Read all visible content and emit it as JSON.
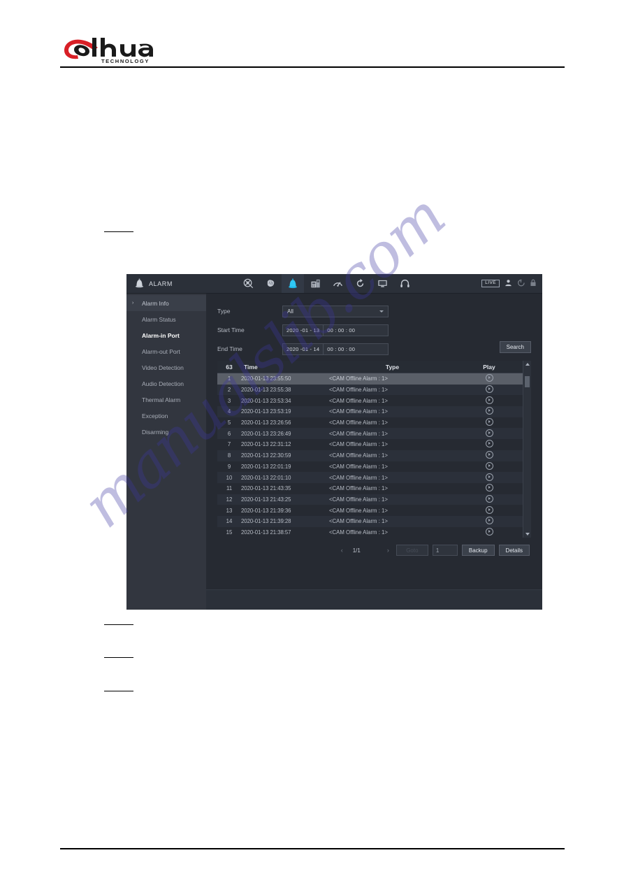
{
  "document": {
    "brand": "alhua",
    "brand_sub": "TECHNOLOGY",
    "watermark": "manualslib.com"
  },
  "nvr": {
    "title": "ALARM",
    "title_icon": "alarm-light-icon",
    "nav_icons": [
      {
        "name": "ai-search-icon",
        "active": false
      },
      {
        "name": "brain-ai-icon",
        "active": false
      },
      {
        "name": "alarm-bell-icon",
        "active": true
      },
      {
        "name": "pos-device-icon",
        "active": false
      },
      {
        "name": "network-speed-icon",
        "active": false
      },
      {
        "name": "maintenance-refresh-icon",
        "active": false
      },
      {
        "name": "display-monitor-icon",
        "active": false
      },
      {
        "name": "audio-headset-icon",
        "active": false
      }
    ],
    "status": {
      "live_badge": "LIVE",
      "icons": [
        "user-account-icon",
        "logout-icon",
        "lock-icon"
      ]
    },
    "sidebar": {
      "items": [
        {
          "label": "Alarm Info",
          "state": "expanded"
        },
        {
          "label": "Alarm Status",
          "state": "normal"
        },
        {
          "label": "Alarm-in Port",
          "state": "selected"
        },
        {
          "label": "Alarm-out Port",
          "state": "normal"
        },
        {
          "label": "Video Detection",
          "state": "normal"
        },
        {
          "label": "Audio Detection",
          "state": "normal"
        },
        {
          "label": "Thermal Alarm",
          "state": "normal"
        },
        {
          "label": "Exception",
          "state": "normal"
        },
        {
          "label": "Disarming",
          "state": "normal"
        }
      ]
    },
    "form": {
      "type_label": "Type",
      "type_value": "All",
      "start_label": "Start Time",
      "start_date": "2020 -01 - 13",
      "start_time": "00 : 00 : 00",
      "end_label": "End Time",
      "end_date": "2020 -01 - 14",
      "end_time": "00 : 00 : 00",
      "search_label": "Search"
    },
    "table": {
      "headers": {
        "count": "63",
        "time": "Time",
        "type": "Type",
        "play": "Play"
      },
      "rows": [
        {
          "no": "1",
          "time": "2020-01-13 23:55:50",
          "type": "<CAM Offline Alarm : 1>",
          "selected": true
        },
        {
          "no": "2",
          "time": "2020-01-13 23:55:38",
          "type": "<CAM Offline Alarm : 1>",
          "selected": false
        },
        {
          "no": "3",
          "time": "2020-01-13 23:53:34",
          "type": "<CAM Offline Alarm : 1>",
          "selected": false
        },
        {
          "no": "4",
          "time": "2020-01-13 23:53:19",
          "type": "<CAM Offline Alarm : 1>",
          "selected": false
        },
        {
          "no": "5",
          "time": "2020-01-13 23:26:56",
          "type": "<CAM Offline Alarm : 1>",
          "selected": false
        },
        {
          "no": "6",
          "time": "2020-01-13 23:26:49",
          "type": "<CAM Offline Alarm : 1>",
          "selected": false
        },
        {
          "no": "7",
          "time": "2020-01-13 22:31:12",
          "type": "<CAM Offline Alarm : 1>",
          "selected": false
        },
        {
          "no": "8",
          "time": "2020-01-13 22:30:59",
          "type": "<CAM Offline Alarm : 1>",
          "selected": false
        },
        {
          "no": "9",
          "time": "2020-01-13 22:01:19",
          "type": "<CAM Offline Alarm : 1>",
          "selected": false
        },
        {
          "no": "10",
          "time": "2020-01-13 22:01:10",
          "type": "<CAM Offline Alarm : 1>",
          "selected": false
        },
        {
          "no": "11",
          "time": "2020-01-13 21:43:35",
          "type": "<CAM Offline Alarm : 1>",
          "selected": false
        },
        {
          "no": "12",
          "time": "2020-01-13 21:43:25",
          "type": "<CAM Offline Alarm : 1>",
          "selected": false
        },
        {
          "no": "13",
          "time": "2020-01-13 21:39:36",
          "type": "<CAM Offline Alarm : 1>",
          "selected": false
        },
        {
          "no": "14",
          "time": "2020-01-13 21:39:28",
          "type": "<CAM Offline Alarm : 1>",
          "selected": false
        },
        {
          "no": "15",
          "time": "2020-01-13 21:38:57",
          "type": "<CAM Offline Alarm : 1>",
          "selected": false
        }
      ]
    },
    "pager": {
      "prev": "‹",
      "page_label": "1/1",
      "next": "›",
      "goto_label": "Goto",
      "page_input": "1",
      "backup_label": "Backup",
      "details_label": "Details"
    }
  }
}
